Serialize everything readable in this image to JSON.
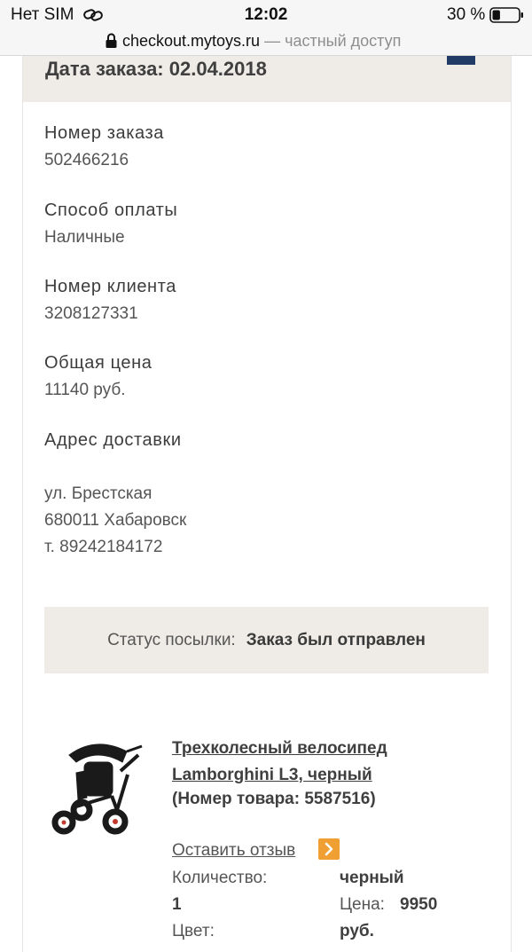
{
  "status_bar": {
    "carrier": "Нет SIM",
    "time": "12:02",
    "battery_percent": "30 %",
    "battery_level": 0.3
  },
  "browser": {
    "url": "checkout.mytoys.ru",
    "private_note": "— частный доступ"
  },
  "order": {
    "date_heading": "Дата заказа: 02.04.2018",
    "fields": [
      {
        "label": "Номер заказа",
        "value": "502466216"
      },
      {
        "label": "Способ оплаты",
        "value": "Наличные"
      },
      {
        "label": "Номер клиента",
        "value": "3208127331"
      },
      {
        "label": "Общая цена",
        "value": "11140 руб."
      }
    ],
    "address": {
      "label": "Адрес доставки",
      "lines": [
        "ул. Брестская",
        "680011 Хабаровск",
        "т. 89242184172"
      ]
    },
    "shipment_status": {
      "label": "Статус посылки:",
      "value": "Заказ был отправлен"
    }
  },
  "product": {
    "title_line1": "Трехколесный велосипед",
    "title_line2": "Lamborghini L3, черный",
    "sku": "(Номер товара: 5587516)",
    "review_link": "Оставить отзыв",
    "quantity_label": "Количество:",
    "quantity_value": "1",
    "color_label": "Цвет:",
    "color_value": "черный",
    "price_label": "Цена:",
    "price_value": "9950",
    "price_unit": "руб."
  }
}
